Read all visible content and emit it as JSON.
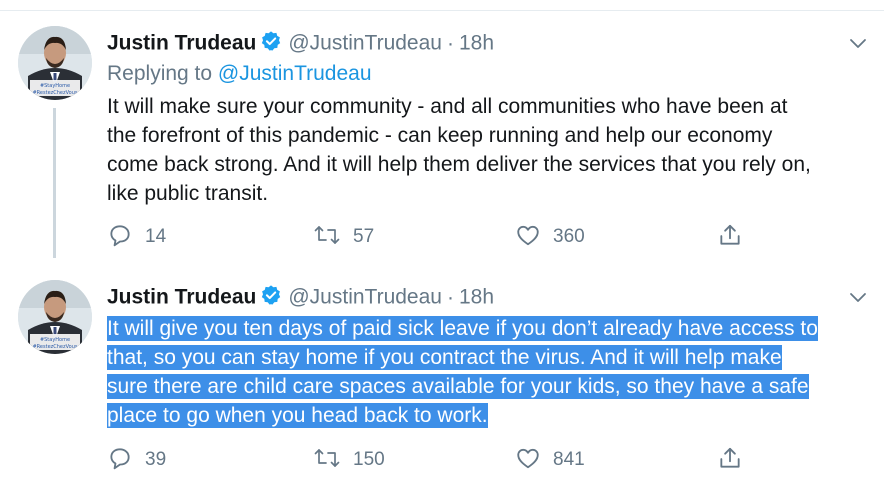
{
  "tweets": [
    {
      "author_name": "Justin Trudeau",
      "author_handle": "@JustinTrudeau",
      "separator": "·",
      "time": "18h",
      "reply_prefix": "Replying to",
      "reply_to": "@JustinTrudeau",
      "avatar_caption": [
        "#StayHome",
        "#RestezChezVous"
      ],
      "lines": [
        "It will make sure your community - and all communities who have been at",
        "the forefront of this pandemic - can keep running and help our economy",
        "come back strong. And it will help them deliver the services that you rely on,",
        "like public transit."
      ],
      "reply_count": "14",
      "retweet_count": "57",
      "like_count": "360"
    },
    {
      "author_name": "Justin Trudeau",
      "author_handle": "@JustinTrudeau",
      "separator": "·",
      "time": "18h",
      "avatar_caption": [
        "#StayHome",
        "#RestezChezVous"
      ],
      "lines": [
        "It will give you ten days of paid sick leave if you don’t already have access to",
        "that, so you can stay home if you contract the virus. And it will help make",
        "sure there are child care spaces available for your kids, so they have a safe",
        "place to go when you head back to work."
      ],
      "text_selected": true,
      "reply_count": "39",
      "retweet_count": "150",
      "like_count": "841"
    }
  ],
  "colors": {
    "primary_text": "#14171a",
    "secondary_text": "#657786",
    "link": "#1b95e0",
    "verified_badge": "#1da1f2",
    "selection_highlight": "#3d8fe8",
    "thread_line": "#ccd6dd"
  },
  "icons": [
    "verified-badge-icon",
    "chevron-down-icon",
    "reply-icon",
    "retweet-icon",
    "like-icon",
    "share-icon"
  ]
}
